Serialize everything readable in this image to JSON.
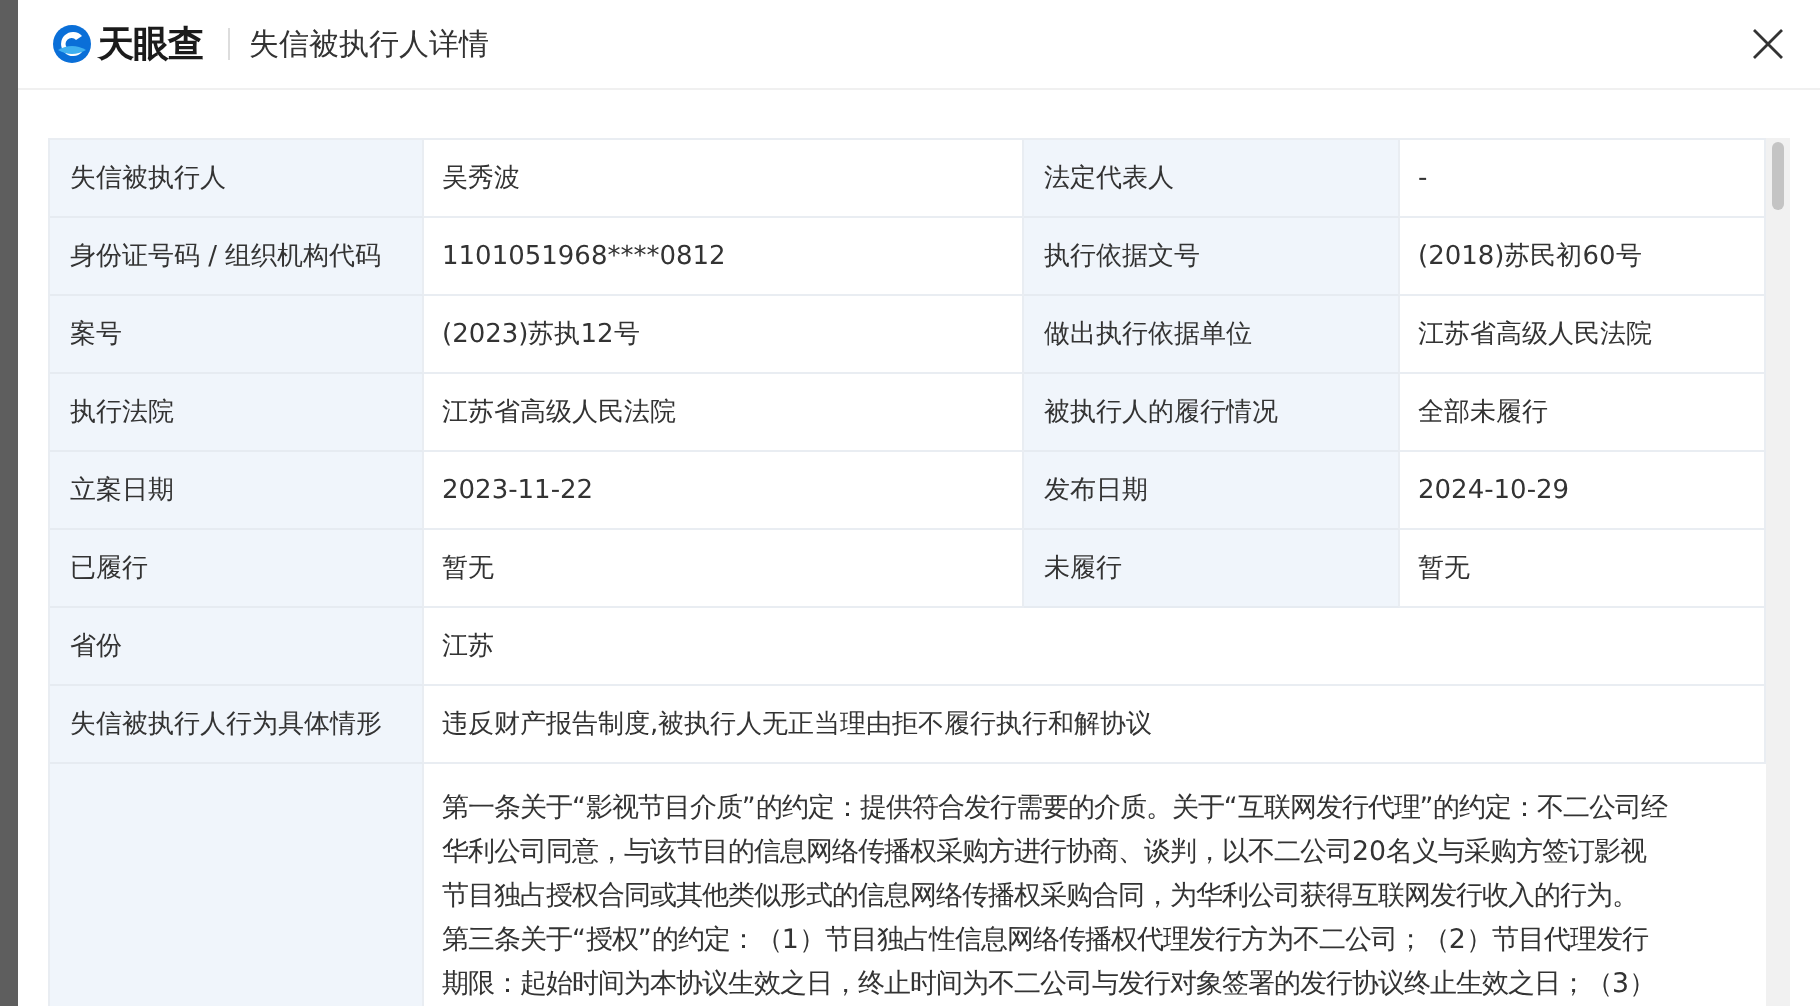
{
  "header": {
    "logo": "天眼查",
    "title": "失信被执行人详情"
  },
  "rows": [
    {
      "kind": "pair",
      "label": "失信被执行人",
      "value": "吴秀波",
      "label_2": "法定代表人",
      "value_2": "-"
    },
    {
      "kind": "pair",
      "label": "身份证号码 / 组织机构代码",
      "value": "1101051968****0812",
      "label_2": "执行依据文号",
      "value_2": "(2018)苏民初60号"
    },
    {
      "kind": "pair",
      "label": "案号",
      "value": "(2023)苏执12号",
      "label_2": "做出执行依据单位",
      "value_2": "江苏省高级人民法院"
    },
    {
      "kind": "pair",
      "label": "执行法院",
      "value": "江苏省高级人民法院",
      "label_2": "被执行人的履行情况",
      "value_2": "全部未履行"
    },
    {
      "kind": "pair",
      "label": "立案日期",
      "value": "2023-11-22",
      "label_2": "发布日期",
      "value_2": "2024-10-29"
    },
    {
      "kind": "pair",
      "label": "已履行",
      "value": "暂无",
      "label_2": "未履行",
      "value_2": "暂无"
    },
    {
      "kind": "single",
      "label": "省份",
      "value": "江苏"
    },
    {
      "kind": "single",
      "label": "失信被执行人行为具体情形",
      "value": "违反财产报告制度,被执行人无正当理由拒不履行执行和解协议"
    },
    {
      "kind": "text",
      "lines": [
        "第一条关于“影视节目介质”的约定：提供符合发行需要的介质。关于“互联网发行代理”的约定：不二公司经",
        "华利公司同意，与该节目的信息网络传播权采购方进行协商、谈判，以不二公司20名义与采购方签订影视",
        "节目独占授权合同或其他类似形式的信息网络传播权采购合同，为华利公司获得互联网发行收入的行为。",
        "第三条关于“授权”的约定：（1）节目独占性信息网络传播权代理发行方为不二公司；（2）节目代理发行",
        "期限：起始时间为本协议生效之日，终止时间为不二公司与发行对象签署的发行协议终止生效之日；（3）"
      ]
    }
  ]
}
